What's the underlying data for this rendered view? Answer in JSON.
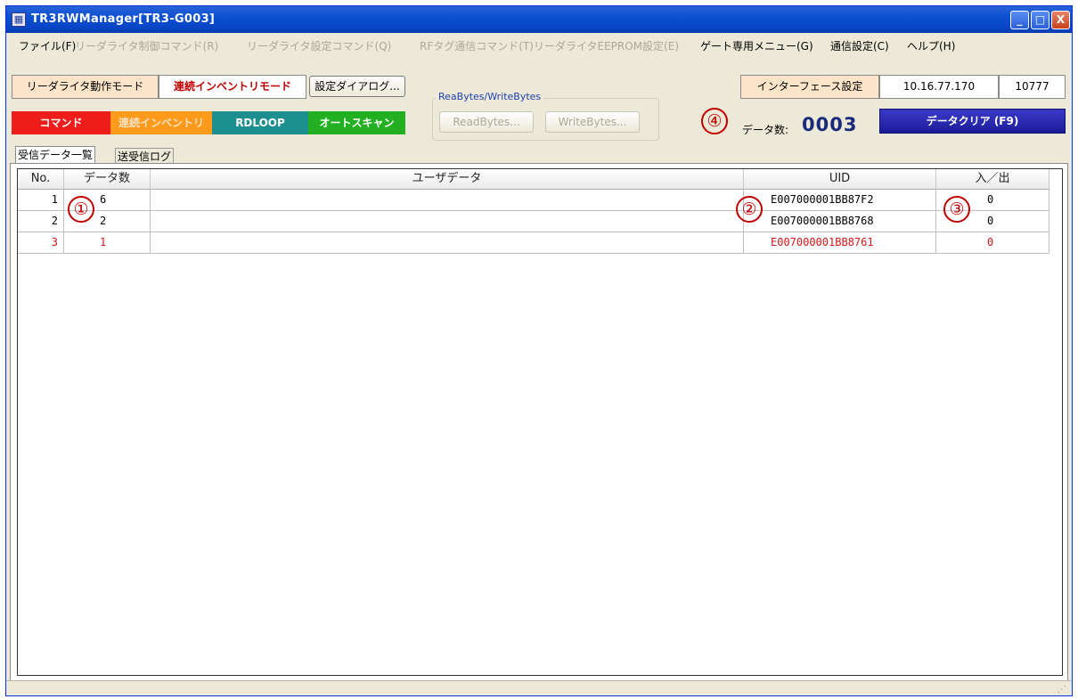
{
  "window": {
    "title": "TR3RWManager[TR3-G003]",
    "app_icon": "app-icon",
    "minimize": "_",
    "maximize": "□",
    "close": "X"
  },
  "menu": [
    {
      "label": "ファイル(F)",
      "enabled": true
    },
    {
      "label": "リーダライタ制御コマンド(R)",
      "enabled": false
    },
    {
      "label": "リーダライタ設定コマンド(Q)",
      "enabled": false
    },
    {
      "label": "RFタグ通信コマンド(T)",
      "enabled": false
    },
    {
      "label": "リーダライタEEPROM設定(E)",
      "enabled": false
    },
    {
      "label": "ゲート専用メニュー(G)",
      "enabled": true
    },
    {
      "label": "通信設定(C)",
      "enabled": true
    },
    {
      "label": "ヘルプ(H)",
      "enabled": true
    }
  ],
  "toolbar": {
    "mode_label": "リーダライタ動作モード",
    "mode_value": "連続インベントリモード",
    "settings_dialog": "設定ダイアログ...",
    "group_title": "ReaBytes/WriteBytes",
    "read_bytes": "ReadBytes...",
    "write_bytes": "WriteBytes...",
    "interface_label": "インターフェース設定",
    "ip": "10.16.77.170",
    "port": "10777",
    "cmd_command": "コマンド",
    "cmd_inventory": "連続インベントリ",
    "cmd_rdloop": "RDLOOP",
    "cmd_autoscan": "オートスキャン",
    "data_count_label": "データ数:",
    "data_count_value": "0003",
    "clear_button": "データクリア (F9)"
  },
  "colors": {
    "command": "#ef1c1c",
    "inventory": "#ff9a1a",
    "rdloop": "#1e8f8f",
    "autoscan": "#22b022",
    "clear": "#2a2ab0",
    "highlight_row": "#d01818"
  },
  "annotations": [
    "①",
    "②",
    "③",
    "④"
  ],
  "tabs": [
    {
      "label": "受信データ一覧",
      "active": true
    },
    {
      "label": "送受信ログ",
      "active": false
    }
  ],
  "table": {
    "columns": [
      "No.",
      "データ数",
      "ユーザデータ",
      "UID",
      "入／出"
    ],
    "rows": [
      {
        "no": "1",
        "count": "6",
        "user": "",
        "uid": "E007000001BB87F2",
        "inout": "0"
      },
      {
        "no": "2",
        "count": "2",
        "user": "",
        "uid": "E007000001BB8768",
        "inout": "0"
      },
      {
        "no": "3",
        "count": "1",
        "user": "",
        "uid": "E007000001BB8761",
        "inout": "0"
      }
    ]
  }
}
